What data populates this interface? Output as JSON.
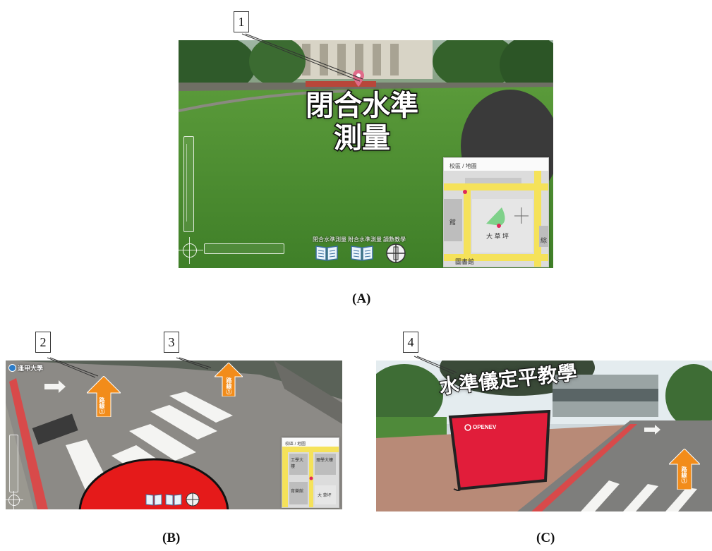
{
  "panelA": {
    "callout": "1",
    "title_line1": "閉合水準",
    "title_line2": "測量",
    "minimap": {
      "title": "校區 / 地圖",
      "labels": [
        "館",
        "大 草 坪",
        "綜",
        "圖書館"
      ]
    },
    "tools": [
      {
        "label": "閉合水準測量",
        "icon": "book-icon"
      },
      {
        "label": "附合水準測量",
        "icon": "book-icon"
      },
      {
        "label": "讀數教學",
        "icon": "leveling-rod-icon"
      }
    ],
    "caption": "(A)"
  },
  "panelB": {
    "callouts": [
      "2",
      "3"
    ],
    "logo": "逢甲大學",
    "arrow1_label": "路線①",
    "arrow2_label": "路線①",
    "minimap": {
      "title": "校區 / 地圖",
      "labels": [
        "工學大樓",
        "理學大樓",
        "育樂館",
        "大 草坪"
      ]
    },
    "caption": "(B)"
  },
  "panelC": {
    "callout": "4",
    "title": "水準儀定平教學",
    "screen_brand": "OPENEV",
    "arrow_label": "路線①",
    "caption": "(C)"
  }
}
